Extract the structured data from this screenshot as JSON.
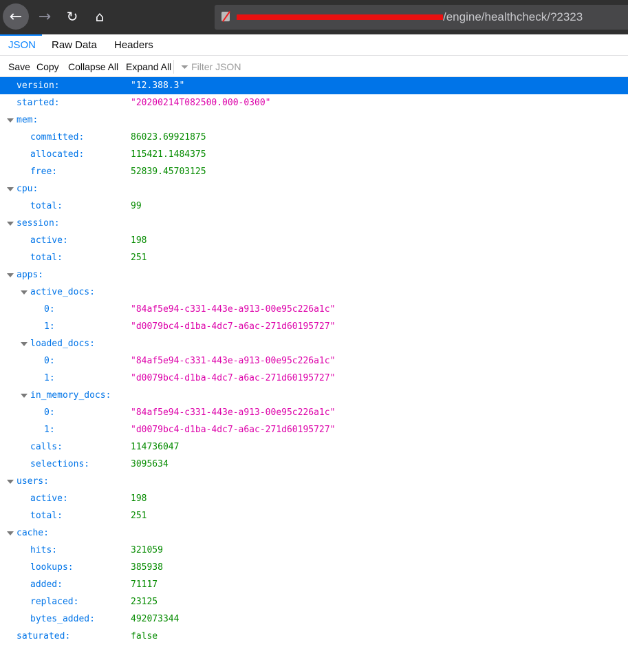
{
  "browser": {
    "url_visible": "/engine/healthcheck/?2323"
  },
  "tabs": [
    {
      "label": "JSON",
      "active": true
    },
    {
      "label": "Raw Data"
    },
    {
      "label": "Headers"
    }
  ],
  "toolbar": {
    "save": "Save",
    "copy": "Copy",
    "collapse_all": "Collapse All",
    "expand_all": "Expand All",
    "filter_placeholder": "Filter JSON"
  },
  "colors": {
    "accent": "#0074e8",
    "string": "#dd00a9",
    "number": "#058b00"
  },
  "rows": [
    {
      "depth": 0,
      "key": "version:",
      "value": "\"12.388.3\"",
      "type": "string",
      "selected": true
    },
    {
      "depth": 0,
      "key": "started:",
      "value": "\"20200214T082500.000-0300\"",
      "type": "string"
    },
    {
      "depth": 0,
      "key": "mem:",
      "expandable": true
    },
    {
      "depth": 1,
      "key": "committed:",
      "value": "86023.69921875",
      "type": "number"
    },
    {
      "depth": 1,
      "key": "allocated:",
      "value": "115421.1484375",
      "type": "number"
    },
    {
      "depth": 1,
      "key": "free:",
      "value": "52839.45703125",
      "type": "number"
    },
    {
      "depth": 0,
      "key": "cpu:",
      "expandable": true
    },
    {
      "depth": 1,
      "key": "total:",
      "value": "99",
      "type": "number"
    },
    {
      "depth": 0,
      "key": "session:",
      "expandable": true
    },
    {
      "depth": 1,
      "key": "active:",
      "value": "198",
      "type": "number"
    },
    {
      "depth": 1,
      "key": "total:",
      "value": "251",
      "type": "number"
    },
    {
      "depth": 0,
      "key": "apps:",
      "expandable": true
    },
    {
      "depth": 1,
      "key": "active_docs:",
      "expandable": true
    },
    {
      "depth": 2,
      "key": "0:",
      "value": "\"84af5e94-c331-443e-a913-00e95c226a1c\"",
      "type": "string"
    },
    {
      "depth": 2,
      "key": "1:",
      "value": "\"d0079bc4-d1ba-4dc7-a6ac-271d60195727\"",
      "type": "string"
    },
    {
      "depth": 1,
      "key": "loaded_docs:",
      "expandable": true
    },
    {
      "depth": 2,
      "key": "0:",
      "value": "\"84af5e94-c331-443e-a913-00e95c226a1c\"",
      "type": "string"
    },
    {
      "depth": 2,
      "key": "1:",
      "value": "\"d0079bc4-d1ba-4dc7-a6ac-271d60195727\"",
      "type": "string"
    },
    {
      "depth": 1,
      "key": "in_memory_docs:",
      "expandable": true
    },
    {
      "depth": 2,
      "key": "0:",
      "value": "\"84af5e94-c331-443e-a913-00e95c226a1c\"",
      "type": "string"
    },
    {
      "depth": 2,
      "key": "1:",
      "value": "\"d0079bc4-d1ba-4dc7-a6ac-271d60195727\"",
      "type": "string"
    },
    {
      "depth": 1,
      "key": "calls:",
      "value": "114736047",
      "type": "number"
    },
    {
      "depth": 1,
      "key": "selections:",
      "value": "3095634",
      "type": "number"
    },
    {
      "depth": 0,
      "key": "users:",
      "expandable": true
    },
    {
      "depth": 1,
      "key": "active:",
      "value": "198",
      "type": "number"
    },
    {
      "depth": 1,
      "key": "total:",
      "value": "251",
      "type": "number"
    },
    {
      "depth": 0,
      "key": "cache:",
      "expandable": true
    },
    {
      "depth": 1,
      "key": "hits:",
      "value": "321059",
      "type": "number"
    },
    {
      "depth": 1,
      "key": "lookups:",
      "value": "385938",
      "type": "number"
    },
    {
      "depth": 1,
      "key": "added:",
      "value": "71117",
      "type": "number"
    },
    {
      "depth": 1,
      "key": "replaced:",
      "value": "23125",
      "type": "number"
    },
    {
      "depth": 1,
      "key": "bytes_added:",
      "value": "492073344",
      "type": "number"
    },
    {
      "depth": 0,
      "key": "saturated:",
      "value": "false",
      "type": "boolean"
    }
  ]
}
